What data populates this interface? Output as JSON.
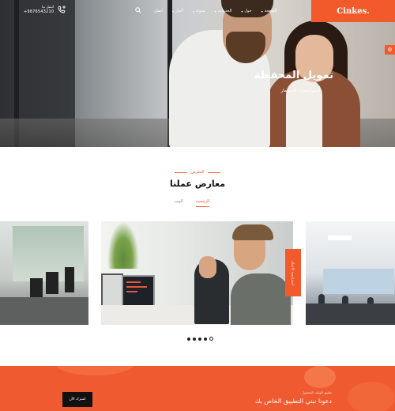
{
  "header": {
    "brand": "Cinkes.",
    "menu": [
      {
        "label": "الصفحة",
        "has_dropdown": true
      },
      {
        "label": "حول",
        "has_dropdown": true
      },
      {
        "label": "الخدمات",
        "has_dropdown": true
      },
      {
        "label": "مدونة",
        "has_dropdown": true
      },
      {
        "label": "أخبار",
        "has_dropdown": true
      },
      {
        "label": "اتصل",
        "has_dropdown": false
      }
    ],
    "phone_label": "اتصل بنا",
    "phone_number": "+9876543210",
    "icons": {
      "search": "search-icon",
      "phone": "phone-plus-icon",
      "side_tab": "gear-icon"
    }
  },
  "hero": {
    "title": "تمويل المحفظة",
    "subtitle": "استراتيجيات الاستثمار"
  },
  "portfolio": {
    "label": "المعرض",
    "title": "معارض عملنا",
    "tabs": [
      {
        "label": "الرئيسية",
        "active": true
      },
      {
        "label": "الويب",
        "active": false
      }
    ],
    "card_tag": "استراتيجية الأعمال",
    "slider": {
      "total": 5,
      "active_index": 4
    }
  },
  "cta": {
    "small_text": "تطبيق الهاتف المحمول",
    "title": "دعونا نبني التطبيق الخاص بك",
    "button_label": "اشترك الآن"
  },
  "colors": {
    "accent": "#f25a2b",
    "cta_bg": "#f05a30",
    "dark": "#111111"
  }
}
